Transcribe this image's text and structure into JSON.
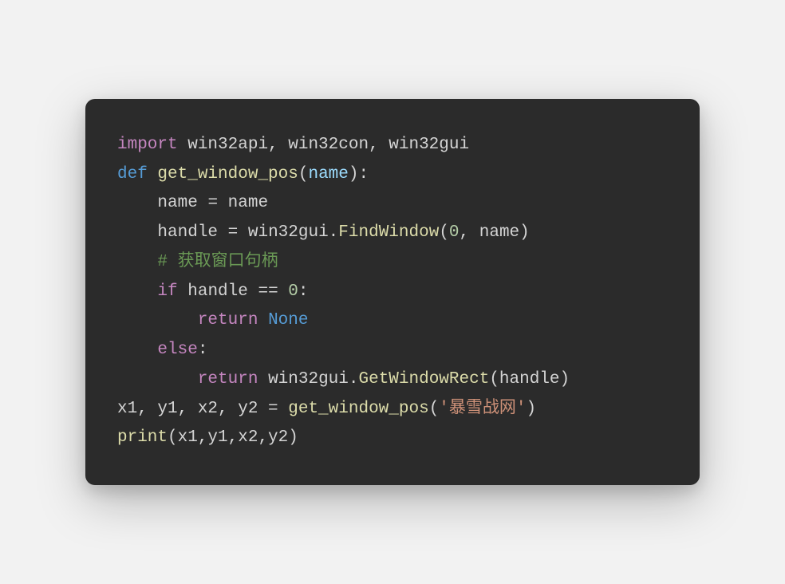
{
  "code": {
    "line1": {
      "import": "import",
      "modules": " win32api, win32con, win32gui"
    },
    "line2": {
      "def": "def",
      "space1": " ",
      "funcname": "get_window_pos",
      "open": "(",
      "param": "name",
      "close": "):"
    },
    "line3": {
      "indent": "    ",
      "lhs": "name",
      "eq": " = ",
      "rhs": "name"
    },
    "line4": {
      "indent": "    ",
      "lhs": "handle",
      "eq": " = ",
      "obj": "win32gui.",
      "method": "FindWindow",
      "open": "(",
      "arg1": "0",
      "comma": ", ",
      "arg2": "name",
      "close": ")"
    },
    "line5": {
      "indent": "    ",
      "comment": "# 获取窗口句柄"
    },
    "line6": {
      "indent": "    ",
      "if": "if",
      "space": " ",
      "lhs": "handle",
      "eq": " == ",
      "rhs": "0",
      "colon": ":"
    },
    "line7": {
      "indent": "        ",
      "return": "return",
      "space": " ",
      "none": "None"
    },
    "line8": {
      "indent": "    ",
      "else": "else",
      "colon": ":"
    },
    "line9": {
      "indent": "        ",
      "return": "return",
      "space": " ",
      "obj": "win32gui.",
      "method": "GetWindowRect",
      "open": "(",
      "arg": "handle",
      "close": ")"
    },
    "line10": {
      "vars": "x1, y1, x2, y2",
      "eq": " = ",
      "func": "get_window_pos",
      "open": "(",
      "str": "'暴雪战网'",
      "close": ")"
    },
    "line11": {
      "func": "print",
      "open": "(",
      "args": "x1,y1,x2,y2",
      "close": ")"
    }
  }
}
